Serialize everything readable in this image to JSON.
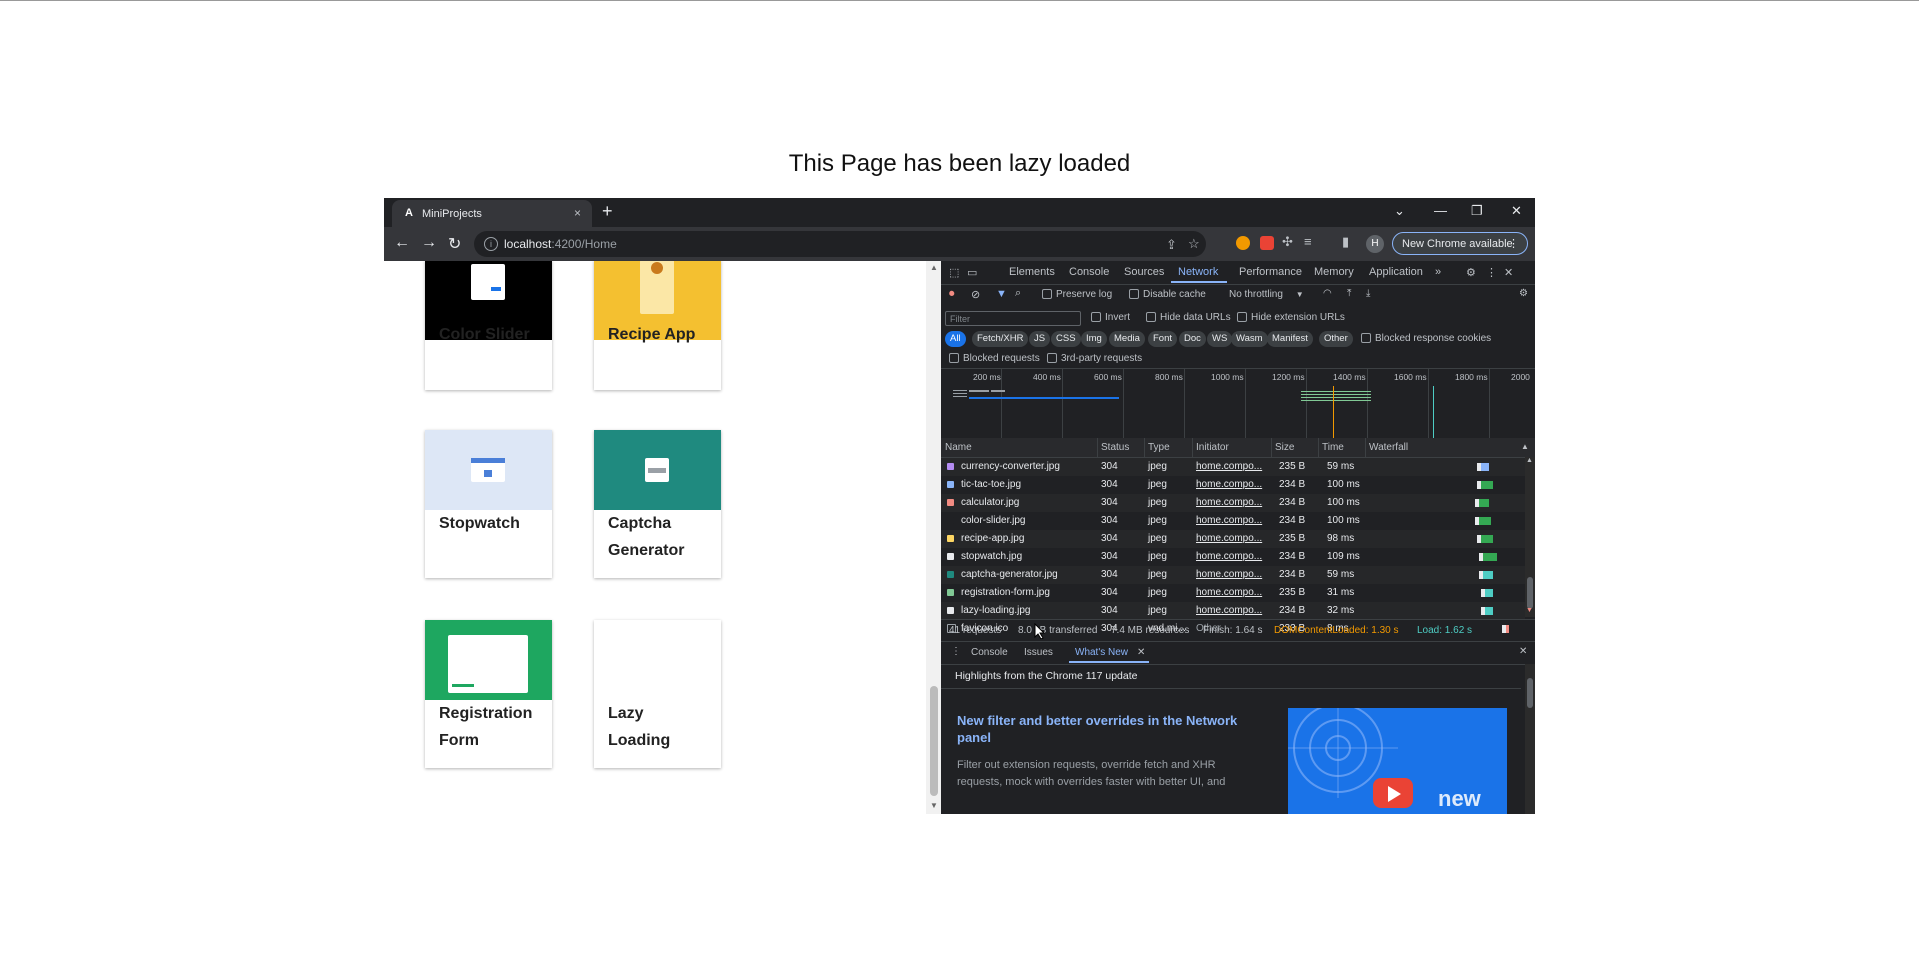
{
  "page": {
    "heading": "This Page has been lazy loaded"
  },
  "browser": {
    "tab_title": "MiniProjects",
    "tab_favicon": "A",
    "tab_close": "×",
    "new_tab": "+",
    "url_host": "localhost",
    "url_path": ":4200/Home",
    "update_button": "New Chrome available",
    "avatar_letter": "H",
    "info_glyph": "i"
  },
  "cards": [
    {
      "label": "Color Slider",
      "thumb_color": "#000000"
    },
    {
      "label": "Recipe App",
      "thumb_color": "#f4c030"
    },
    {
      "label": "Stopwatch",
      "thumb_color": "#dde7f6"
    },
    {
      "label": "Captcha Generator",
      "thumb_color": "#1f8a7f"
    },
    {
      "label": "Registration Form",
      "thumb_color": "#1ea760"
    },
    {
      "label": "Lazy Loading",
      "thumb_color": "#ffffff"
    }
  ],
  "devtools": {
    "tabs": [
      "Elements",
      "Console",
      "Sources",
      "Network",
      "Performance",
      "Memory",
      "Application"
    ],
    "active_tab": "Network",
    "toolbar": {
      "preserve_log": "Preserve log",
      "disable_cache": "Disable cache",
      "throttling": "No throttling"
    },
    "filter": {
      "placeholder": "Filter",
      "invert": "Invert",
      "hide_data_urls": "Hide data URLs",
      "hide_extension_urls": "Hide extension URLs",
      "types": [
        "All",
        "Fetch/XHR",
        "JS",
        "CSS",
        "Img",
        "Media",
        "Font",
        "Doc",
        "WS",
        "Wasm",
        "Manifest",
        "Other"
      ],
      "active_type": "All",
      "blocked_response_cookies": "Blocked response cookies",
      "blocked_requests": "Blocked requests",
      "third_party_requests": "3rd-party requests"
    },
    "overview_ticks": [
      "200 ms",
      "400 ms",
      "600 ms",
      "800 ms",
      "1000 ms",
      "1200 ms",
      "1400 ms",
      "1600 ms",
      "1800 ms",
      "2000"
    ],
    "columns": [
      "Name",
      "Status",
      "Type",
      "Initiator",
      "Size",
      "Time",
      "Waterfall"
    ],
    "rows": [
      {
        "name": "currency-converter.jpg",
        "status": "304",
        "type": "jpeg",
        "initiator": "home.compo...",
        "size": "235 B",
        "time": "59 ms",
        "icon_color": "#b48cf2"
      },
      {
        "name": "tic-tac-toe.jpg",
        "status": "304",
        "type": "jpeg",
        "initiator": "home.compo...",
        "size": "234 B",
        "time": "100 ms",
        "icon_color": "#8ab4f8"
      },
      {
        "name": "calculator.jpg",
        "status": "304",
        "type": "jpeg",
        "initiator": "home.compo...",
        "size": "234 B",
        "time": "100 ms",
        "icon_color": "#f28b82"
      },
      {
        "name": "color-slider.jpg",
        "status": "304",
        "type": "jpeg",
        "initiator": "home.compo...",
        "size": "234 B",
        "time": "100 ms",
        "icon_color": "#202124"
      },
      {
        "name": "recipe-app.jpg",
        "status": "304",
        "type": "jpeg",
        "initiator": "home.compo...",
        "size": "235 B",
        "time": "98 ms",
        "icon_color": "#fdd663"
      },
      {
        "name": "stopwatch.jpg",
        "status": "304",
        "type": "jpeg",
        "initiator": "home.compo...",
        "size": "234 B",
        "time": "109 ms",
        "icon_color": "#e8eaed"
      },
      {
        "name": "captcha-generator.jpg",
        "status": "304",
        "type": "jpeg",
        "initiator": "home.compo...",
        "size": "234 B",
        "time": "59 ms",
        "icon_color": "#1f8a7f"
      },
      {
        "name": "registration-form.jpg",
        "status": "304",
        "type": "jpeg",
        "initiator": "home.compo...",
        "size": "235 B",
        "time": "31 ms",
        "icon_color": "#81c995"
      },
      {
        "name": "lazy-loading.jpg",
        "status": "304",
        "type": "jpeg",
        "initiator": "home.compo...",
        "size": "234 B",
        "time": "32 ms",
        "icon_color": "#e8eaed"
      },
      {
        "name": "favicon.ico",
        "status": "304",
        "type": "vnd.mi...",
        "initiator": "Other",
        "size": "233 B",
        "time": "8 ms",
        "icon_color": "#202124"
      }
    ],
    "summary": {
      "requests": "41 requests",
      "transferred": "8.0 kB transferred",
      "resources": "7.4 MB resources",
      "finish": "Finish: 1.64 s",
      "dcl": "DOMContentLoaded: 1.30 s",
      "load": "Load: 1.62 s",
      "dcl_color": "#f29900",
      "load_color": "#4ecdc4"
    },
    "drawer": {
      "tabs": [
        "Console",
        "Issues",
        "What's New"
      ],
      "active_tab": "What's New",
      "highlights": "Highlights from the Chrome 117 update",
      "article_title": "New filter and better overrides in the Network panel",
      "article_desc": "Filter out extension requests, override fetch and XHR requests, mock with overrides faster with better UI, and"
    }
  },
  "colors": {
    "accent": "#8ab4f8",
    "chrome_dark": "#202124"
  }
}
